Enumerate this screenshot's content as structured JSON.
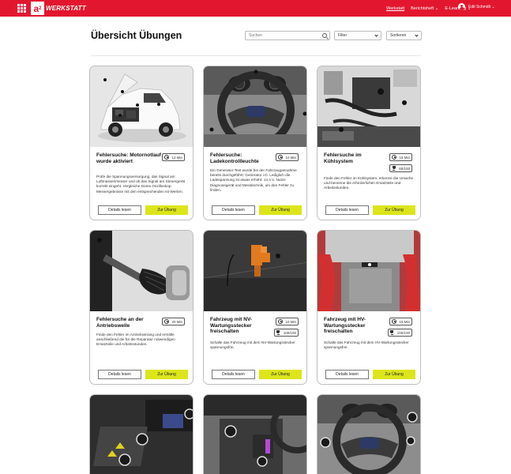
{
  "header": {
    "logo_letter": "a",
    "logo_sub": "2",
    "logo_text": "WERKSTATT",
    "nav": [
      {
        "label": "Werkstatt",
        "active": true
      },
      {
        "label": "Berichtsheft"
      },
      {
        "label": "E-Learning"
      }
    ],
    "user_name": "Edit Schmidt"
  },
  "page": {
    "title": "Übersicht Übungen",
    "search_placeholder": "Suchen",
    "filter_label": "Filter",
    "sort_label": "Sortieren"
  },
  "colors": {
    "brand": "#e2172f",
    "accent_button": "#dce51a"
  },
  "icons": [
    "apps-grid-icon",
    "user-avatar-icon",
    "search-icon",
    "chevron-down-icon",
    "clock-icon",
    "trophy-icon"
  ],
  "cards": [
    {
      "title": "Fehlersuche: Motornotlauf wurde aktiviert",
      "duration": "12 Min",
      "score": "",
      "description": "Prüfe die Spannungsversorgung, das Signal am Luftmassenmesser und ob das Signal am Steuergerät korrekt eingeht. Vergleiche Deine Oszilloskop-Messergebnisse mit den entsprechenden Ist-Werten.",
      "details_label": "Details lesen",
      "start_label": "Zur Übung"
    },
    {
      "title": "Fehlersuche: Ladekontrollleuchte",
      "duration": "10 Min",
      "score": "",
      "description": "Ein Generator-Test wurde bei der Fahrzeugannahme bereits durchgeführt: Generator i.O. Lediglich die Ladespannung ist etwas erhöht: 14,4 V. Nutze Diagnosegerät und Messtechnik, um den Fehler zu finden.",
      "details_label": "Details lesen",
      "start_label": "Zur Übung"
    },
    {
      "title": "Fehlersuche im Kühlsystem",
      "duration": "15 Min",
      "score": "60/100",
      "description": "Finde den Fehler im Kühlsystem, erkenne die Ursache und benenne die erforderlichen Ersatzteile und Arbeitsstunden.",
      "details_label": "Details lesen",
      "start_label": "Zur Übung"
    },
    {
      "title": "Fehlersuche an der Antriebswelle",
      "duration": "20 Min",
      "score": "",
      "description": "Finde den Fehler im Antriebsstrang und ermittle anschließend die für die Reparatur notwendigen Ersatzteile und Arbeitsstunden.",
      "details_label": "Details lesen",
      "start_label": "Zur Übung"
    },
    {
      "title": "Fahrzeug mit NV-Wartungsstecker freischalten",
      "duration": "10 Min",
      "score": "100/100",
      "description": "Schalte das Fahrzeug mit dem NV-Wartungsstecker spannungsfrei.",
      "details_label": "Details lesen",
      "start_label": "Zur Übung"
    },
    {
      "title": "Fahrzeug mit HV-Wartungsstecker freischalten",
      "duration": "15 Min",
      "score": "100/100",
      "description": "Schalte das Fahrzeug mit dem HV-Wartungsstecker spannungsfrei.",
      "details_label": "Details lesen",
      "start_label": "Zur Übung"
    }
  ]
}
